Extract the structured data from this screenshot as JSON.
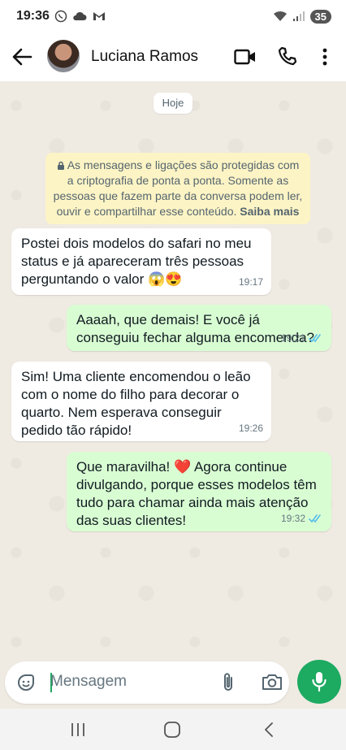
{
  "status_bar": {
    "time": "19:36",
    "battery": "35"
  },
  "header": {
    "contact_name": "Luciana Ramos"
  },
  "chat": {
    "date_label": "Hoje",
    "encryption_notice": "As mensagens e ligações são protegidas com a criptografia de ponta a ponta. Somente as pessoas que fazem parte da conversa podem ler, ouvir e compartilhar esse conteúdo.",
    "encryption_link": "Saiba mais",
    "messages": [
      {
        "direction": "incoming",
        "text": "Postei dois modelos do safari no meu status e já apareceram três pessoas perguntando o valor 😱😍",
        "time": "19:17"
      },
      {
        "direction": "outgoing",
        "text": "Aaaah, que demais! E você já conseguiu fechar alguma encomenda?",
        "time": "19:21",
        "status": "read"
      },
      {
        "direction": "incoming",
        "text": "Sim! Uma cliente encomendou o leão com o nome do filho para decorar o quarto. Nem esperava conseguir pedido tão rápido!",
        "time": "19:26"
      },
      {
        "direction": "outgoing",
        "text": "Que maravilha! ❤️ Agora continue divulgando, porque esses modelos têm tudo para chamar ainda mais atenção das suas clientes!",
        "time": "19:32",
        "status": "read"
      }
    ]
  },
  "composer": {
    "placeholder": "Mensagem"
  },
  "colors": {
    "outgoing_bubble": "#d9fdd3",
    "accent_green": "#1daa61",
    "read_ticks": "#53bdeb",
    "notice_bg": "#fdf4c5"
  }
}
